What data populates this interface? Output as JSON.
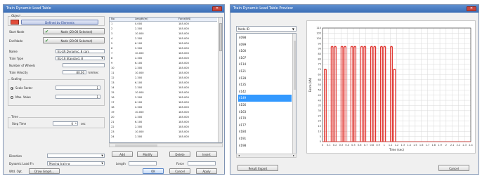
{
  "left_window": {
    "title": "Train Dynamic Load Table",
    "object_group": "Object",
    "object_button": "Defined by Elements",
    "start_node_label": "Start Node",
    "start_node_button": "Node (20:00 Selected)",
    "end_node_label": "End Node",
    "end_node_button": "Node (20:00 Selected)",
    "name_label": "Name",
    "name_value": "EL-LN Dynamic, 8 cars",
    "train_type_label": "Train Type",
    "train_type_value": "BL-16 Standard, 8",
    "num_wheels_label": "Number of Wheels",
    "num_wheels_value": "",
    "train_velocity_label": "Train Velocity",
    "train_velocity_value": "80.00",
    "train_velocity_unit": "km/sec",
    "scaling_group": "Scaling",
    "scale_factor_label": "Scale Factor",
    "scale_factor_value": "1",
    "max_value_label": "Max. Value",
    "max_value_value": "1",
    "time_group": "Time",
    "step_time_label": "Step Time",
    "step_time_value": "0",
    "step_time_unit": "sec",
    "direction_label": "Direction",
    "direction_value": "",
    "dynamic_load_fn_label": "Dynamic Load Fn",
    "dynamic_load_fn_value": "Moving train w",
    "add_button": "Add",
    "modify_button": "Modify",
    "delete_button": "Delete",
    "insert_button": "Insert",
    "length_label": "Length",
    "force_label": "Force",
    "bottom_left_label": "Wtd. Opt.",
    "bottom_left_button": "Draw Graph...",
    "ok_button": "OK",
    "cancel_button": "Cancel",
    "apply_button": "Apply",
    "table": {
      "headers": [
        "No",
        "Length(m)",
        "Force(kN)"
      ],
      "rows": [
        [
          "1",
          "0.000",
          "185.000"
        ],
        [
          "2",
          "2.300",
          "185.000"
        ],
        [
          "3",
          "10.000",
          "185.000"
        ],
        [
          "4",
          "2.300",
          "185.000"
        ],
        [
          "5",
          "6.100",
          "185.000"
        ],
        [
          "6",
          "2.300",
          "185.000"
        ],
        [
          "7",
          "10.000",
          "185.000"
        ],
        [
          "8",
          "2.300",
          "185.000"
        ],
        [
          "9",
          "6.100",
          "185.000"
        ],
        [
          "10",
          "2.300",
          "185.000"
        ],
        [
          "11",
          "10.000",
          "185.000"
        ],
        [
          "12",
          "2.300",
          "185.000"
        ],
        [
          "13",
          "6.100",
          "185.000"
        ],
        [
          "14",
          "2.300",
          "185.000"
        ],
        [
          "15",
          "10.000",
          "185.000"
        ],
        [
          "16",
          "2.300",
          "185.000"
        ],
        [
          "17",
          "6.100",
          "185.000"
        ],
        [
          "18",
          "2.300",
          "185.000"
        ],
        [
          "19",
          "10.000",
          "185.000"
        ],
        [
          "20",
          "2.300",
          "185.000"
        ],
        [
          "21",
          "6.100",
          "185.000"
        ],
        [
          "22",
          "2.300",
          "185.000"
        ],
        [
          "23",
          "10.000",
          "185.000"
        ],
        [
          "24",
          "2.300",
          "185.000"
        ]
      ]
    }
  },
  "right_window": {
    "title": "Train Dynamic Load Table Preview",
    "combo_value": "Node ID",
    "nodes": [
      "4098",
      "4099",
      "4100",
      "4107",
      "4114",
      "4121",
      "4128",
      "4135",
      "4142",
      "4149",
      "4156",
      "4163",
      "4170",
      "4177",
      "4184",
      "4191",
      "4198"
    ],
    "selected_index": 9,
    "result_export_button": "Result Export",
    "cancel_button": "Cancel",
    "accent_color": "#e0302a"
  },
  "chart_data": {
    "type": "line",
    "title": "",
    "xlabel": "Time (sec)",
    "ylabel": "Force (kN)",
    "xlim": [
      0,
      2.4
    ],
    "ylim": [
      0,
      110
    ],
    "x_ticks": [
      "0",
      "0.1",
      "0.2",
      "0.3",
      "0.4",
      "0.5",
      "0.6",
      "0.7",
      "0.8",
      "0.9",
      "1",
      "1.1",
      "1.2",
      "1.3",
      "1.4",
      "1.5",
      "1.6",
      "1.7",
      "1.8",
      "1.9",
      "2",
      "2.1",
      "2.2",
      "2.3",
      "2.4"
    ],
    "y_ticks": [
      "0",
      "5",
      "10",
      "15",
      "20",
      "25",
      "30",
      "35",
      "40",
      "45",
      "50",
      "55",
      "60",
      "65",
      "70",
      "75",
      "80",
      "85",
      "90",
      "95",
      "100",
      "105",
      "110"
    ],
    "grid": true,
    "series": [
      {
        "color": "#e0302a",
        "peaks": [
          [
            0.03,
            70
          ],
          [
            0.06,
            70
          ],
          [
            0.14,
            92
          ],
          [
            0.17,
            92
          ],
          [
            0.19,
            92
          ],
          [
            0.22,
            92
          ],
          [
            0.3,
            92
          ],
          [
            0.33,
            92
          ],
          [
            0.35,
            92
          ],
          [
            0.38,
            92
          ],
          [
            0.46,
            92
          ],
          [
            0.49,
            92
          ],
          [
            0.51,
            92
          ],
          [
            0.54,
            92
          ],
          [
            0.62,
            92
          ],
          [
            0.65,
            92
          ],
          [
            0.67,
            92
          ],
          [
            0.7,
            92
          ],
          [
            0.78,
            92
          ],
          [
            0.81,
            92
          ],
          [
            0.83,
            92
          ],
          [
            0.86,
            92
          ],
          [
            0.94,
            92
          ],
          [
            0.97,
            92
          ],
          [
            0.99,
            92
          ],
          [
            1.02,
            92
          ],
          [
            1.1,
            92
          ],
          [
            1.13,
            92
          ],
          [
            1.15,
            70
          ],
          [
            1.18,
            70
          ]
        ]
      }
    ]
  }
}
